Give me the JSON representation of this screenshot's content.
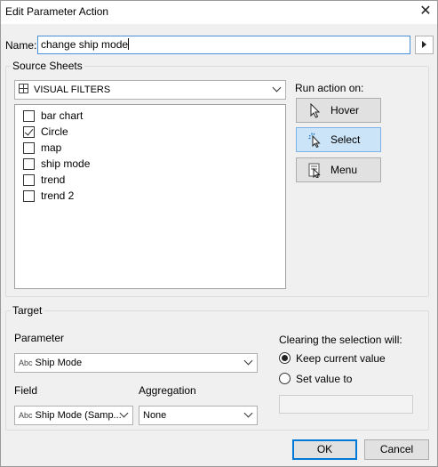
{
  "window": {
    "title": "Edit Parameter Action",
    "close_glyph": "✕"
  },
  "name_field": {
    "label": "Name:",
    "value": "change ship mode"
  },
  "source_sheets": {
    "group_title": "Source Sheets",
    "dashboard_select": {
      "value": "VISUAL FILTERS",
      "icon": "dashboard-grid-icon"
    },
    "sheets": [
      {
        "label": "bar chart",
        "checked": false
      },
      {
        "label": "Circle",
        "checked": true
      },
      {
        "label": "map",
        "checked": false
      },
      {
        "label": "ship mode",
        "checked": false
      },
      {
        "label": "trend",
        "checked": false
      },
      {
        "label": "trend 2",
        "checked": false
      }
    ],
    "run_action": {
      "label": "Run action on:",
      "options": [
        {
          "label": "Hover",
          "icon": "hover-cursor-icon",
          "selected": false
        },
        {
          "label": "Select",
          "icon": "select-cursor-icon",
          "selected": true
        },
        {
          "label": "Menu",
          "icon": "menu-cursor-icon",
          "selected": false
        }
      ]
    }
  },
  "target": {
    "group_title": "Target",
    "parameter": {
      "label": "Parameter",
      "type_badge": "Abc",
      "value": "Ship Mode"
    },
    "field": {
      "label": "Field",
      "type_badge": "Abc",
      "value": "Ship Mode (Samp..."
    },
    "aggregation": {
      "label": "Aggregation",
      "value": "None"
    },
    "clearing": {
      "label": "Clearing the selection will:",
      "options": [
        {
          "label": "Keep current value",
          "selected": true
        },
        {
          "label": "Set value to",
          "selected": false
        }
      ],
      "set_value": ""
    }
  },
  "buttons": {
    "ok": "OK",
    "cancel": "Cancel"
  },
  "colors": {
    "focus_border": "#4a90d9",
    "selected_button_bg": "#cce4f7",
    "default_button_border": "#0078d7"
  }
}
